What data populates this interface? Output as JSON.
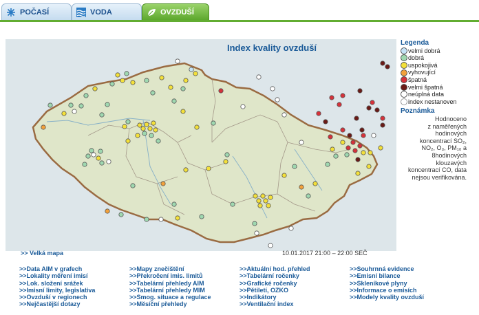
{
  "tabs": [
    {
      "label": "POČASÍ",
      "icon": "sun-icon"
    },
    {
      "label": "VODA",
      "icon": "waves-icon"
    },
    {
      "label": "OVZDUŠÍ",
      "icon": "leaf-icon"
    }
  ],
  "map": {
    "title": "Index kvality ovzduší",
    "big_map_link": ">> Velká mapa",
    "timestamp": "10.01.2017 21:00 – 22:00 SEČ"
  },
  "legend": {
    "title": "Legenda",
    "items": [
      {
        "label": "velmi dobrá",
        "color": "#c5e3f7"
      },
      {
        "label": "dobrá",
        "color": "#9fd8b0"
      },
      {
        "label": "uspokojivá",
        "color": "#f3e03a"
      },
      {
        "label": "vyhovující",
        "color": "#f2a13b"
      },
      {
        "label": "špatná",
        "color": "#d5323a"
      },
      {
        "label": "velmi špatná",
        "color": "#6a1a16"
      },
      {
        "label": "neúplná data",
        "color": "#ffffff"
      },
      {
        "label": "index nestanoven",
        "color": "#ffffff"
      }
    ],
    "note_title": "Poznámka",
    "note_lines": [
      "Hodnoceno",
      "z naměřených",
      "hodinových",
      "koncentrací SO₂,",
      "NO₂, O₃, PM₁₀ a",
      "8hodinových",
      "klouzavých",
      "koncentrací CO, data",
      "nejsou verifikována."
    ]
  },
  "links": {
    "col1": [
      "Data AIM v grafech",
      "Lokality měření imisí",
      "Lok. složení srážek",
      "Imisní limity, legislativa",
      "Ovzduší v regionech",
      "Nejčastější dotazy"
    ],
    "col2": [
      "Mapy znečištění",
      "Překročení imis. limitů",
      "Tabelární přehledy AIM",
      "Tabelární přehledy MIM",
      "Smog. situace a regulace",
      "Měsíční přehledy"
    ],
    "col3": [
      "Aktuální hod. přehled",
      "Tabelární ročenky",
      "Grafické ročenky",
      "Pětiletí, OZKO",
      "Indikátory",
      "Ventilační index"
    ],
    "col4": [
      "Souhrnná evidence",
      "Emisní bilance",
      "Skleníkové plyny",
      "Informace o emisích",
      "Modely kvality ovzduší"
    ],
    "arrow": ">>"
  }
}
